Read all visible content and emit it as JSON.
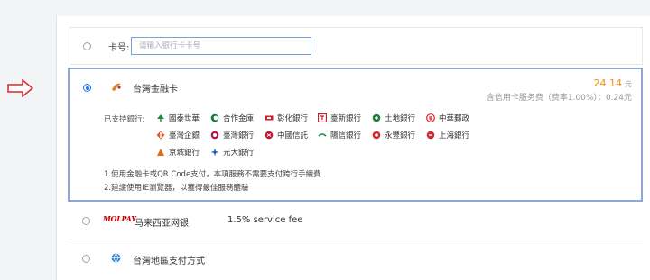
{
  "card_input": {
    "label": "卡号:",
    "placeholder": "请输入银行卡卡号"
  },
  "taiwan_card": {
    "title": "台灣金融卡",
    "amount": "24.14",
    "currency": "元",
    "fee_note": "含信用卡服务费（费率1.00%）：0.24元",
    "supported_label": "已支持銀行:",
    "banks": [
      {
        "name": "國泰世華",
        "icon": "cathay-tree-icon",
        "color": "#1f8a3b"
      },
      {
        "name": "合作金庫",
        "icon": "tcb-icon",
        "color": "#117a3e"
      },
      {
        "name": "彰化銀行",
        "icon": "chb-icon",
        "color": "#d21f2b"
      },
      {
        "name": "臺新銀行",
        "icon": "taishin-icon",
        "color": "#c81e2d"
      },
      {
        "name": "土地銀行",
        "icon": "landbank-icon",
        "color": "#1a7f3c"
      },
      {
        "name": "中華郵政",
        "icon": "post-icon",
        "color": "#d8232a"
      },
      {
        "name": "臺灣企銀",
        "icon": "tbb-icon",
        "color": "#e5582a"
      },
      {
        "name": "臺灣銀行",
        "icon": "bot-icon",
        "color": "#b5123f"
      },
      {
        "name": "中國信託",
        "icon": "ctbc-icon",
        "color": "#c8102e"
      },
      {
        "name": "陽信銀行",
        "icon": "sunny-icon",
        "color": "#1e8f4e"
      },
      {
        "name": "永豐銀行",
        "icon": "sinopac-icon",
        "color": "#d9262c"
      },
      {
        "name": "上海銀行",
        "icon": "scsb-icon",
        "color": "#d62a2a"
      },
      {
        "name": "京城銀行",
        "icon": "ktb-icon",
        "color": "#e06a1b"
      },
      {
        "name": "元大銀行",
        "icon": "yuanta-icon",
        "color": "#1560b0"
      }
    ],
    "notes": [
      "1.使用金融卡或QR Code支付，本項服務不需要支付跨行手續費",
      "2.建議使用IE瀏覽器，以獲得最佳服務體驗"
    ]
  },
  "malaysia": {
    "logo_text": "MOLPAY",
    "title": "马来西亚网银",
    "fee": "1.5% service fee"
  },
  "taiwan_region": {
    "title": "台灣地區支付方式"
  },
  "colors": {
    "accent": "#1a73e8",
    "amount": "#f08a24",
    "selected_border": "#8fa7d4",
    "arrow": "#d9262c"
  }
}
